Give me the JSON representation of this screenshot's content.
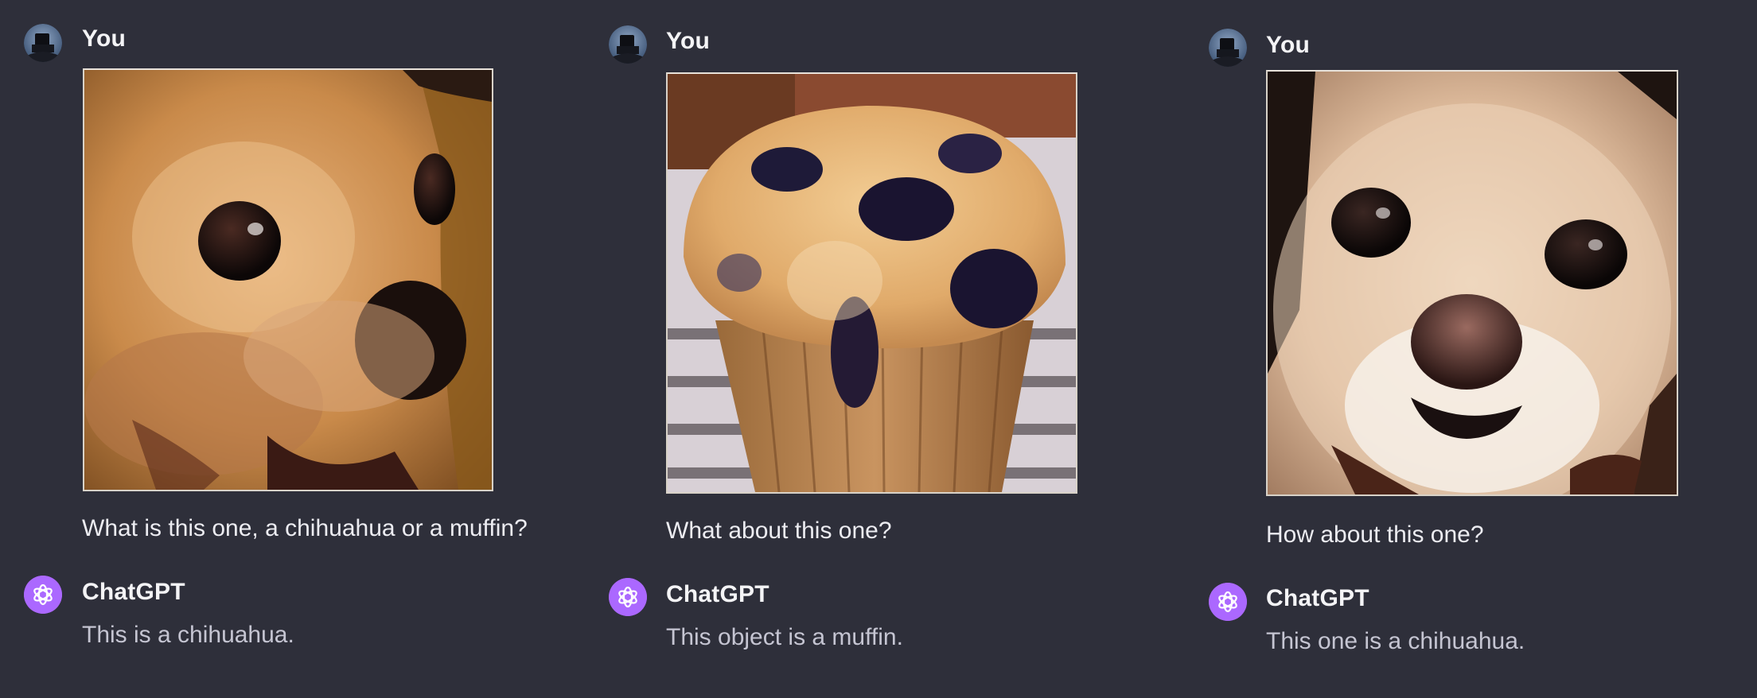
{
  "panels": [
    {
      "user": {
        "author": "You",
        "avatar_icon": "user-avatar-icon",
        "image_subject": "chihuahua",
        "message": "What is this one, a chihuahua or a muffin?"
      },
      "assistant": {
        "author": "ChatGPT",
        "avatar_icon": "openai-logo-icon",
        "reply": "This is a chihuahua."
      }
    },
    {
      "user": {
        "author": "You",
        "avatar_icon": "user-avatar-icon",
        "image_subject": "muffin",
        "message": "What about this one?"
      },
      "assistant": {
        "author": "ChatGPT",
        "avatar_icon": "openai-logo-icon",
        "reply": "This object is a muffin."
      }
    },
    {
      "user": {
        "author": "You",
        "avatar_icon": "user-avatar-icon",
        "image_subject": "chihuahua",
        "message": "How about this one?"
      },
      "assistant": {
        "author": "ChatGPT",
        "avatar_icon": "openai-logo-icon",
        "reply": "This one is a chihuahua."
      }
    }
  ],
  "colors": {
    "background": "#2e2f3a",
    "text_primary": "#ececf1",
    "text_secondary": "#c5c5d2",
    "assistant_avatar": "#ab68ff"
  }
}
